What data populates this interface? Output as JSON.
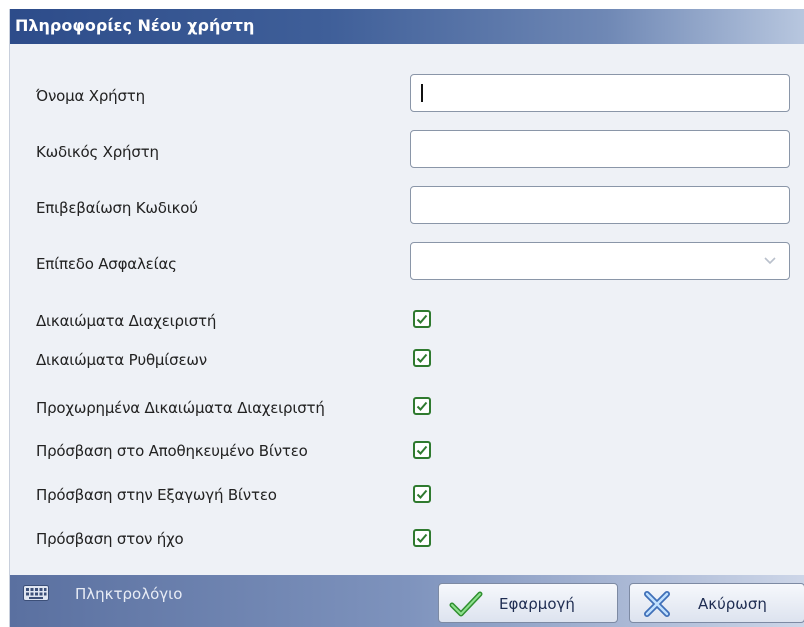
{
  "dialog": {
    "title": "Πληροφορίες Νέου χρήστη"
  },
  "fields": {
    "username_label": "Όνομα Χρήστη",
    "username_value": "",
    "password_label": "Κωδικός Χρήστη",
    "password_value": "",
    "confirm_label": "Επιβεβαίωση Κωδικού",
    "confirm_value": "",
    "security_label": "Επίπεδο Ασφαλείας",
    "security_value": ""
  },
  "permissions": [
    {
      "label": "Δικαιώματα Διαχειριστή",
      "checked": true
    },
    {
      "label": "Δικαιώματα Ρυθμίσεων",
      "checked": true
    },
    {
      "label": "Προχωρημένα Δικαιώματα Διαχειριστή",
      "checked": true
    },
    {
      "label": "Πρόσβαση στο Αποθηκευμένο Βίντεο",
      "checked": true
    },
    {
      "label": "Πρόσβαση στην Εξαγωγή Βίντεο",
      "checked": true
    },
    {
      "label": "Πρόσβαση στον ήχο",
      "checked": true
    }
  ],
  "footer": {
    "keyboard_label": "Πληκτρολόγιο",
    "keyboard_icon": "keyboard-icon",
    "apply_label": "Εφαρμογή",
    "apply_icon": "checkmark-icon",
    "cancel_label": "Ακύρωση",
    "cancel_icon": "x-icon"
  },
  "colors": {
    "title_bar": "#2d4c8a",
    "check": "#2f7a2f",
    "footer": "#5a70a0"
  }
}
